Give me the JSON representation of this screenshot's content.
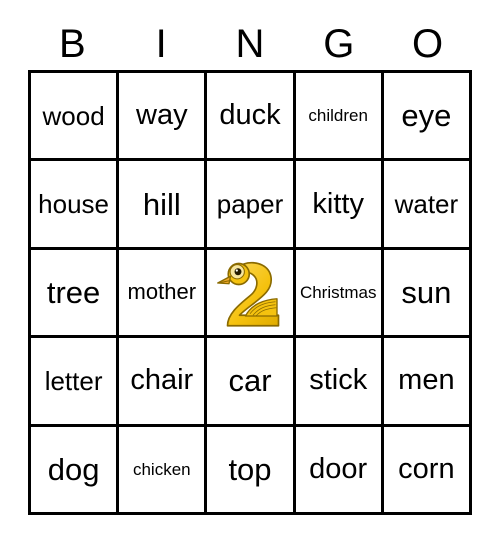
{
  "card": {
    "title": "BINGO",
    "header": {
      "letters": [
        "B",
        "I",
        "N",
        "G",
        "O"
      ]
    },
    "colors": {
      "border": "#000000",
      "background": "#ffffff",
      "text": "#000000",
      "duck_body": "#f5c20f",
      "duck_body_light": "#fbd95c",
      "duck_outline": "#8a6a00",
      "duck_beak": "#f0a92a",
      "duck_eye": "#221a00",
      "duck_head_fill": "#f7e6a0"
    },
    "grid": {
      "rows": 5,
      "columns": 5,
      "cells": [
        [
          {
            "text": "wood",
            "size": "md",
            "type": "word"
          },
          {
            "text": "way",
            "size": "lg",
            "type": "word"
          },
          {
            "text": "duck",
            "size": "lg",
            "type": "word"
          },
          {
            "text": "children",
            "size": "xs",
            "type": "word"
          },
          {
            "text": "eye",
            "size": "xl",
            "type": "word"
          }
        ],
        [
          {
            "text": "house",
            "size": "md",
            "type": "word"
          },
          {
            "text": "hill",
            "size": "xl",
            "type": "word"
          },
          {
            "text": "paper",
            "size": "md",
            "type": "word"
          },
          {
            "text": "kitty",
            "size": "lg",
            "type": "word"
          },
          {
            "text": "water",
            "size": "md",
            "type": "word"
          }
        ],
        [
          {
            "text": "tree",
            "size": "xl",
            "type": "word"
          },
          {
            "text": "mother",
            "size": "sm",
            "type": "word"
          },
          {
            "text": "",
            "size": "md",
            "type": "image",
            "icon": "duck-image"
          },
          {
            "text": "Christmas",
            "size": "xs",
            "type": "word"
          },
          {
            "text": "sun",
            "size": "xl",
            "type": "word"
          }
        ],
        [
          {
            "text": "letter",
            "size": "md",
            "type": "word"
          },
          {
            "text": "chair",
            "size": "lg",
            "type": "word"
          },
          {
            "text": "car",
            "size": "xl",
            "type": "word"
          },
          {
            "text": "stick",
            "size": "lg",
            "type": "word"
          },
          {
            "text": "men",
            "size": "lg",
            "type": "word"
          }
        ],
        [
          {
            "text": "dog",
            "size": "xl",
            "type": "word"
          },
          {
            "text": "chicken",
            "size": "xs",
            "type": "word"
          },
          {
            "text": "top",
            "size": "xl",
            "type": "word"
          },
          {
            "text": "door",
            "size": "lg",
            "type": "word"
          },
          {
            "text": "corn",
            "size": "lg",
            "type": "word"
          }
        ]
      ]
    },
    "free_space": {
      "icon": "duck-image",
      "label": "duck"
    }
  }
}
